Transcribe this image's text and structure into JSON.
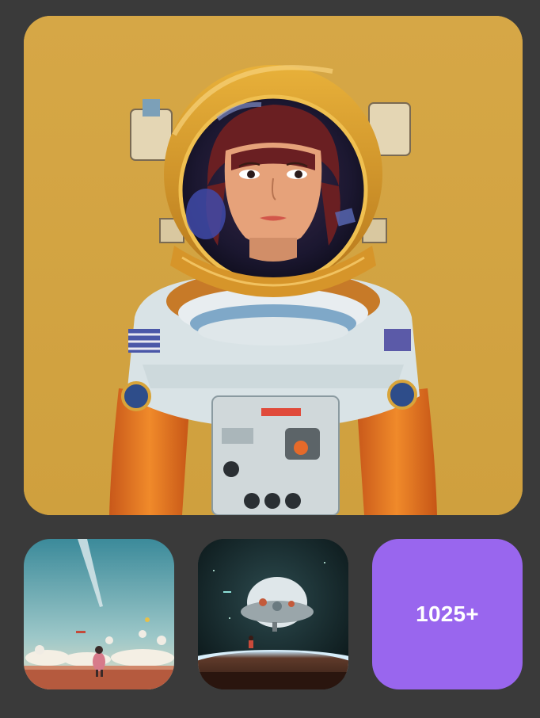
{
  "gallery": {
    "hero_image": "astronaut-woman-helmet-illustration",
    "thumbnails": [
      {
        "image": "child-in-field-with-balloons-illustration"
      },
      {
        "image": "spaceship-over-planet-illustration"
      }
    ],
    "more_tile": {
      "count_label": "1025+",
      "color": "#9966ee"
    }
  },
  "colors": {
    "background": "#3a3a3a",
    "hero_background": "#d3a443"
  }
}
